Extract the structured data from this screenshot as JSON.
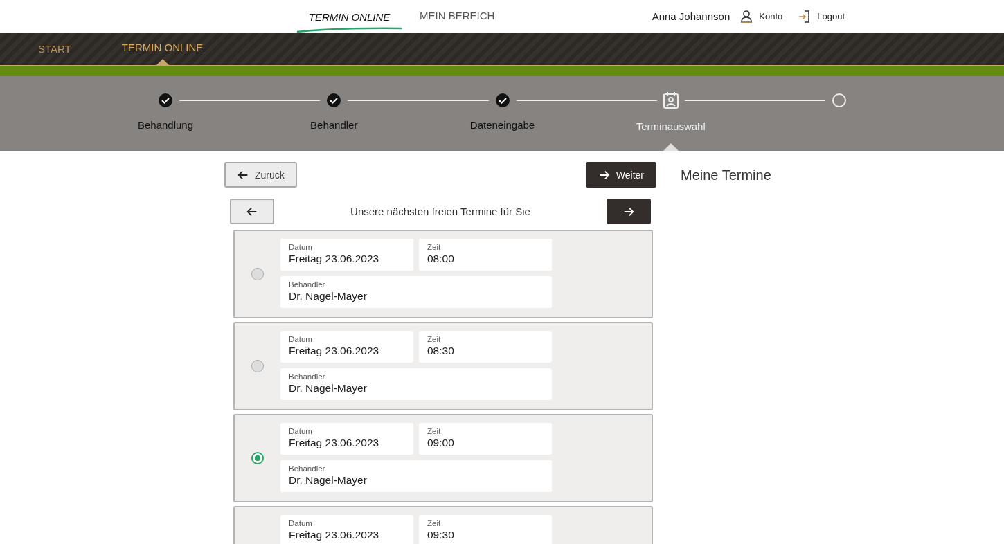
{
  "top_nav": {
    "items": [
      {
        "label": "TERMIN ONLINE",
        "selected": true
      },
      {
        "label": "MEIN BEREICH",
        "selected": false
      }
    ],
    "user_name": "Anna Johannson",
    "account": "Konto",
    "logout": "Logout"
  },
  "breadcrumb": [
    {
      "label": "START",
      "selected": false
    },
    {
      "label": "TERMIN ONLINE",
      "selected": true
    }
  ],
  "steps": [
    {
      "label": "Behandlung",
      "done": true,
      "current": false
    },
    {
      "label": "Behandler",
      "done": true,
      "current": false
    },
    {
      "label": "Dateneingabe",
      "done": true,
      "current": false
    },
    {
      "label": "Terminauswahl",
      "done": false,
      "current": true
    },
    {
      "done": false,
      "current": false
    }
  ],
  "back_button": "Zurück",
  "next_button": "Weiter",
  "slots_heading": "Unsere nächsten freien Termine für Sie",
  "slots": [
    {
      "selected": false,
      "date_label": "Datum",
      "date": "Freitag 23.06.2023",
      "time_label": "Zeit",
      "time": "08:00",
      "doctor_label": "Behandler",
      "doctor": "Dr. Nagel-Mayer"
    },
    {
      "selected": false,
      "date_label": "Datum",
      "date": "Freitag 23.06.2023",
      "time_label": "Zeit",
      "time": "08:30",
      "doctor_label": "Behandler",
      "doctor": "Dr. Nagel-Mayer"
    },
    {
      "selected": true,
      "date_label": "Datum",
      "date": "Freitag 23.06.2023",
      "time_label": "Zeit",
      "time": "09:00",
      "doctor_label": "Behandler",
      "doctor": "Dr. Nagel-Mayer"
    },
    {
      "date_label": "Datum",
      "date": "Freitag 23.06.2023",
      "time_label": "Zeit",
      "time": "09:30"
    }
  ],
  "side_heading": "Meine Termine"
}
